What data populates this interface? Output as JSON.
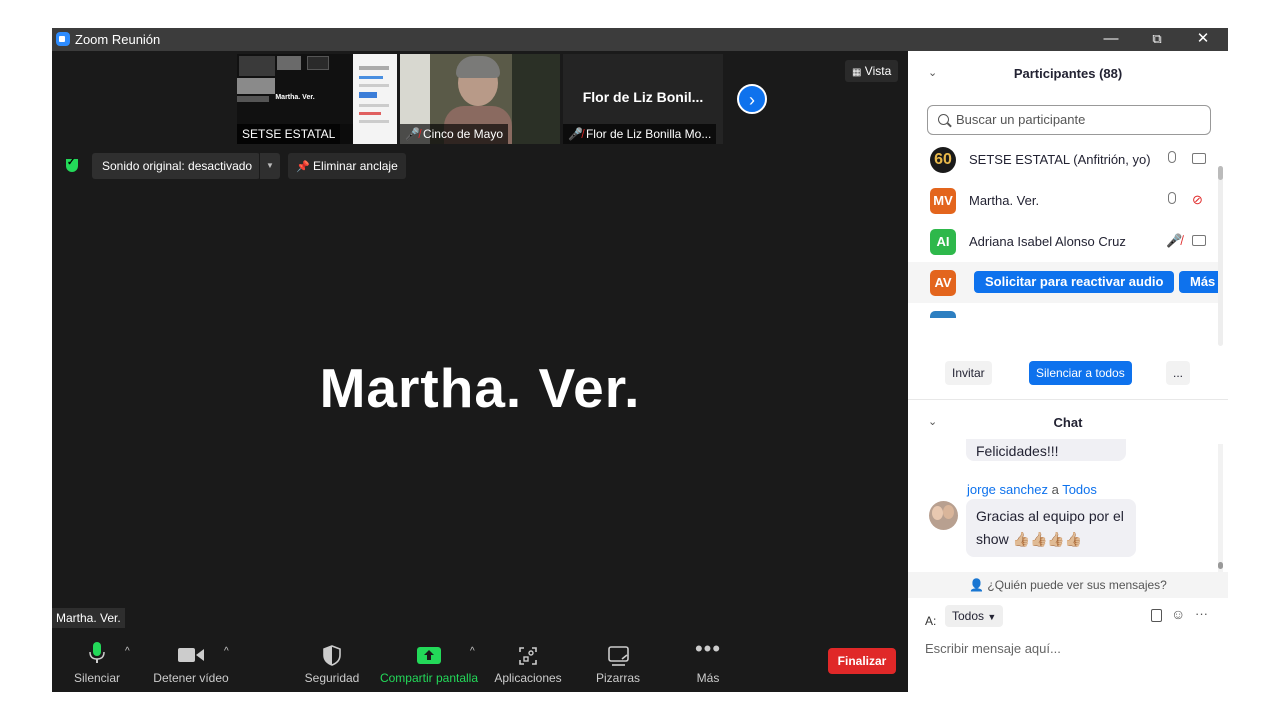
{
  "window": {
    "title": "Zoom Reunión",
    "minimize": "—",
    "restore": "⧉",
    "close": "✕"
  },
  "thumbnails": [
    {
      "label": "SETSE ESTATAL",
      "preview_text": "Martha. Ver."
    },
    {
      "label": "Cinco de Mayo"
    },
    {
      "label": "Flor de Liz Bonilla Mo...",
      "center_name": "Flor de Liz Bonil..."
    }
  ],
  "view": {
    "label": "Vista"
  },
  "controls": {
    "original_sound": "Sonido original: desactivado",
    "unpin": "Eliminar anclaje"
  },
  "main": {
    "speaker_name": "Martha.  Ver.",
    "name_tag": "Martha.  Ver."
  },
  "toolbar": {
    "mute": "Silenciar",
    "stop_video": "Detener vídeo",
    "security": "Seguridad",
    "share_screen": "Compartir pantalla",
    "apps": "Aplicaciones",
    "whiteboards": "Pizarras",
    "more": "Más",
    "end": "Finalizar"
  },
  "participants": {
    "title": "Participantes (88)",
    "search_placeholder": "Buscar un participante",
    "list": [
      {
        "initials": "60",
        "name": "SETSE ESTATAL (Anfitrión, yo)",
        "color": "#1a1a1a",
        "mic": "on",
        "video": "on"
      },
      {
        "initials": "MV",
        "name": "Martha.  Ver.",
        "color": "#e3651d",
        "mic": "on",
        "video": "off"
      },
      {
        "initials": "AI",
        "name": "Adriana Isabel Alonso Cruz",
        "color": "#2eb84b",
        "mic": "off",
        "video": "on"
      },
      {
        "initials": "AV",
        "color": "#e3651d",
        "request_audio": "Solicitar para reactivar audio",
        "more": "Más"
      }
    ],
    "invite": "Invitar",
    "mute_all": "Silenciar a todos",
    "more": "..."
  },
  "chat": {
    "title": "Chat",
    "messages": [
      {
        "text": "Felicidades!!!"
      },
      {
        "sender": "jorge sanchez",
        "to_word": "a",
        "to": "Todos",
        "text": "Gracias al equipo por el show 👍🏼👍🏼👍🏼👍🏼"
      }
    ],
    "visibility": "¿Quién puede ver sus mensajes?",
    "to_label": "A:",
    "to_value": "Todos",
    "input_placeholder": "Escribir mensaje aquí..."
  }
}
